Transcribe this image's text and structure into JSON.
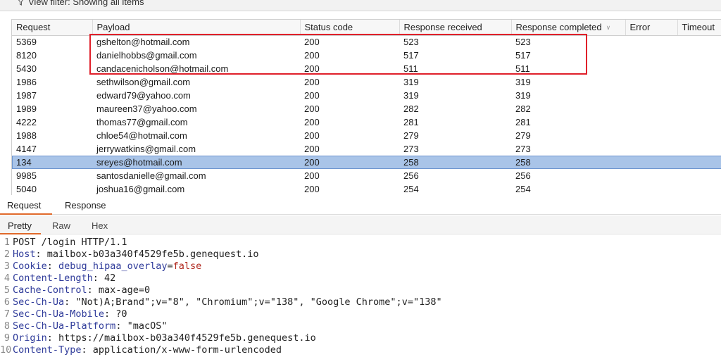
{
  "filter": {
    "label": "View filter: Showing all items"
  },
  "table": {
    "columns": [
      "Request",
      "Payload",
      "Status code",
      "Response received",
      "Response completed",
      "Error",
      "Timeout"
    ],
    "rows": [
      {
        "request": "5369",
        "payload": "gshelton@hotmail.com",
        "status": "200",
        "received": "523",
        "completed": "523"
      },
      {
        "request": "8120",
        "payload": "danielhobbs@gmail.com",
        "status": "200",
        "received": "517",
        "completed": "517"
      },
      {
        "request": "5430",
        "payload": "candacenicholson@hotmail.com",
        "status": "200",
        "received": "511",
        "completed": "511"
      },
      {
        "request": "1986",
        "payload": "sethwilson@gmail.com",
        "status": "200",
        "received": "319",
        "completed": "319"
      },
      {
        "request": "1987",
        "payload": "edward79@yahoo.com",
        "status": "200",
        "received": "319",
        "completed": "319"
      },
      {
        "request": "1989",
        "payload": "maureen37@yahoo.com",
        "status": "200",
        "received": "282",
        "completed": "282"
      },
      {
        "request": "4222",
        "payload": "thomas77@gmail.com",
        "status": "200",
        "received": "281",
        "completed": "281"
      },
      {
        "request": "1988",
        "payload": "chloe54@hotmail.com",
        "status": "200",
        "received": "279",
        "completed": "279"
      },
      {
        "request": "4147",
        "payload": "jerrywatkins@gmail.com",
        "status": "200",
        "received": "273",
        "completed": "273"
      },
      {
        "request": "134",
        "payload": "sreyes@hotmail.com",
        "status": "200",
        "received": "258",
        "completed": "258"
      },
      {
        "request": "9985",
        "payload": "santosdanielle@gmail.com",
        "status": "200",
        "received": "256",
        "completed": "256"
      },
      {
        "request": "5040",
        "payload": "joshua16@gmail.com",
        "status": "200",
        "received": "254",
        "completed": "254"
      }
    ],
    "selected_request": "134"
  },
  "panel_tabs": {
    "request": "Request",
    "response": "Response"
  },
  "view_tabs": {
    "pretty": "Pretty",
    "raw": "Raw",
    "hex": "Hex"
  },
  "code_lines": [
    {
      "n": "1",
      "parts": [
        {
          "t": "POST /login HTTP/1.1",
          "c": "plain"
        }
      ]
    },
    {
      "n": "2",
      "parts": [
        {
          "t": "Host",
          "c": "key"
        },
        {
          "t": ": mailbox-b03a340f4529fe5b.genequest.io",
          "c": "val"
        }
      ]
    },
    {
      "n": "3",
      "parts": [
        {
          "t": "Cookie",
          "c": "key"
        },
        {
          "t": ": ",
          "c": "val"
        },
        {
          "t": "debug_hipaa_overlay",
          "c": "key"
        },
        {
          "t": "=",
          "c": "val"
        },
        {
          "t": "false",
          "c": "val-red"
        }
      ]
    },
    {
      "n": "4",
      "parts": [
        {
          "t": "Content-Length",
          "c": "key"
        },
        {
          "t": ": 42",
          "c": "val"
        }
      ]
    },
    {
      "n": "5",
      "parts": [
        {
          "t": "Cache-Control",
          "c": "key"
        },
        {
          "t": ": max-age=0",
          "c": "val"
        }
      ]
    },
    {
      "n": "6",
      "parts": [
        {
          "t": "Sec-Ch-Ua",
          "c": "key"
        },
        {
          "t": ": \"Not)A;Brand\";v=\"8\", \"Chromium\";v=\"138\", \"Google Chrome\";v=\"138\"",
          "c": "val"
        }
      ]
    },
    {
      "n": "7",
      "parts": [
        {
          "t": "Sec-Ch-Ua-Mobile",
          "c": "key"
        },
        {
          "t": ": ?0",
          "c": "val"
        }
      ]
    },
    {
      "n": "8",
      "parts": [
        {
          "t": "Sec-Ch-Ua-Platform",
          "c": "key"
        },
        {
          "t": ": \"macOS\"",
          "c": "val"
        }
      ]
    },
    {
      "n": "9",
      "parts": [
        {
          "t": "Origin",
          "c": "key"
        },
        {
          "t": ": https://mailbox-b03a340f4529fe5b.genequest.io",
          "c": "val"
        }
      ]
    },
    {
      "n": "10",
      "parts": [
        {
          "t": "Content-Type",
          "c": "key"
        },
        {
          "t": ": application/x-www-form-urlencoded",
          "c": "val"
        }
      ]
    }
  ],
  "colors": {
    "accent": "#e06a2c",
    "selection": "#a9c4e8",
    "highlight_box": "#e0202a"
  }
}
